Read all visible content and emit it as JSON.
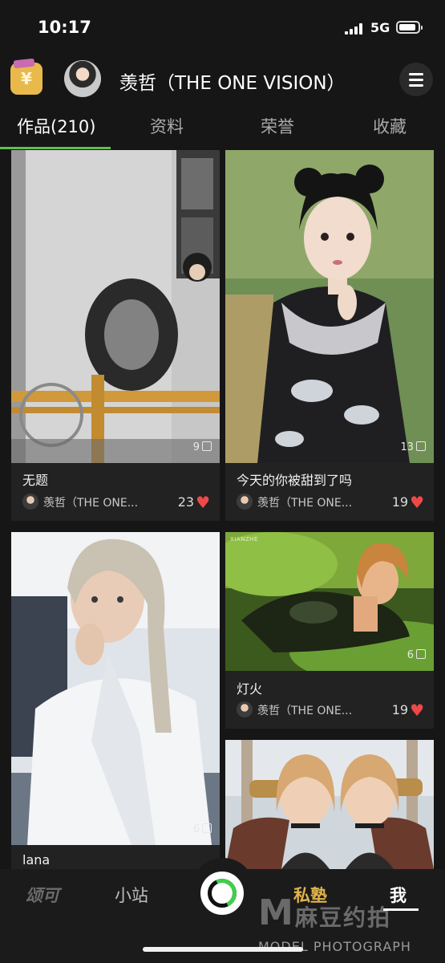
{
  "status_bar": {
    "time": "10:17",
    "network": "5G"
  },
  "header": {
    "title": "羡哲（THE ONE VISION）",
    "wallet_symbol": "¥"
  },
  "tabs": [
    {
      "label": "作品(210)",
      "active": true
    },
    {
      "label": "资料",
      "active": false
    },
    {
      "label": "荣誉",
      "active": false
    },
    {
      "label": "收藏",
      "active": false
    }
  ],
  "cards": [
    {
      "title": "无题",
      "count": "9",
      "author": "羡哲（THE ONE...",
      "likes": "23"
    },
    {
      "title": "今天的你被甜到了吗",
      "count": "13",
      "author": "羡哲（THE ONE...",
      "likes": "19"
    },
    {
      "title": "lana",
      "count": "6"
    },
    {
      "title": "灯火",
      "count": "6",
      "author": "羡哲（THE ONE...",
      "likes": "19",
      "photo_caption": "XIANZHE"
    },
    {
      "title": ""
    }
  ],
  "bottom_nav": {
    "items": [
      "颂可",
      "小站",
      "私塾",
      "我"
    ],
    "active": "我"
  },
  "watermark": {
    "logo": "M",
    "cn": "麻豆约拍",
    "en": "MODEL PHOTOGRAPH"
  },
  "colors": {
    "accent": "#5fbf4f",
    "heart": "#f04848",
    "background": "#161616",
    "card": "#222222"
  }
}
